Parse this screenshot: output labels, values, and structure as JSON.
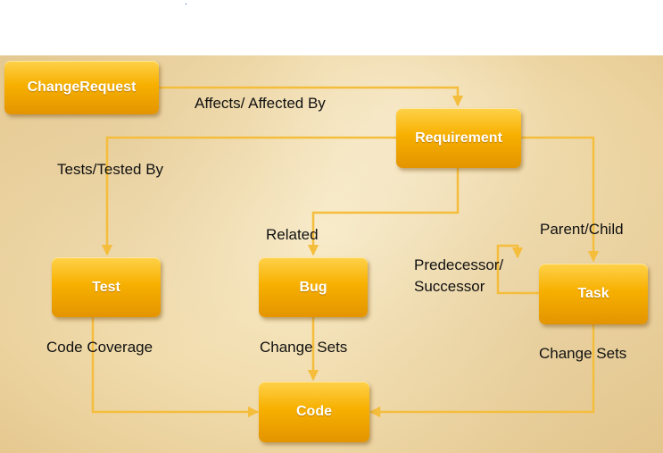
{
  "nodes": {
    "change_request": "ChangeRequest",
    "requirement": "Requirement",
    "test": "Test",
    "bug": "Bug",
    "task": "Task",
    "code": "Code"
  },
  "links": {
    "affects": "Affects/ Affected By",
    "tests": "Tests/Tested By",
    "related": "Related",
    "parent_child": "Parent/Child",
    "predecessor": "Predecessor/",
    "successor": "Successor",
    "code_coverage": "Code Coverage",
    "change_sets_bug": "Change Sets",
    "change_sets_task": "Change Sets"
  },
  "colors": {
    "connector": "#f5bd3c",
    "node_top": "#ffd24a",
    "node_bottom": "#e39400"
  }
}
